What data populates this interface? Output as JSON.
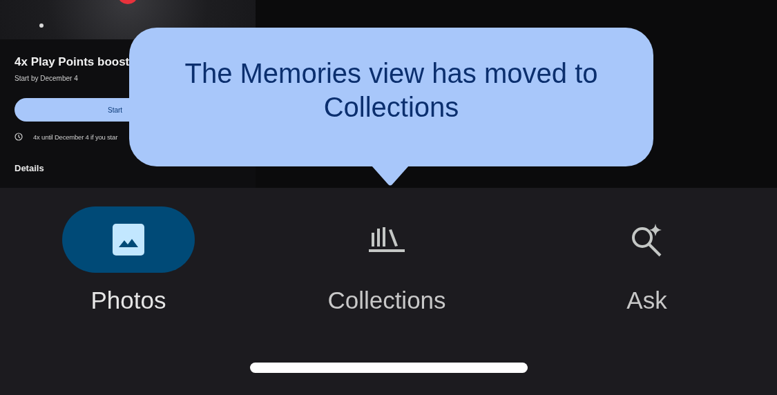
{
  "promo_card": {
    "title": "4x Play Points boost",
    "subtitle": "Start by December 4",
    "button": "Start",
    "note": "4x until December 4 if you star",
    "section": "Details"
  },
  "tooltip": {
    "text": "The Memories view has moved to Collections"
  },
  "nav": [
    {
      "label": "Photos",
      "selected": true,
      "kind": "photos"
    },
    {
      "label": "Collections",
      "selected": false,
      "kind": "collections"
    },
    {
      "label": "Ask",
      "selected": false,
      "kind": "ask"
    }
  ]
}
